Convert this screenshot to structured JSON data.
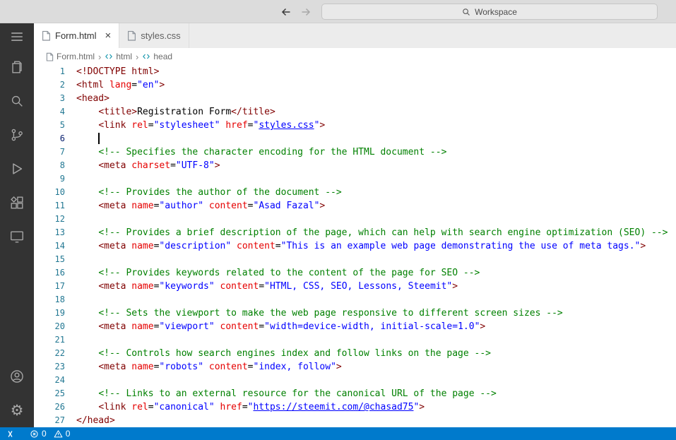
{
  "title_bar": {
    "search_label": "Workspace"
  },
  "activity_bar": {
    "icons": [
      "menu",
      "explorer",
      "search",
      "source-control",
      "run-and-debug",
      "extensions",
      "remote-explorer"
    ],
    "bottom_icons": [
      "account",
      "settings"
    ]
  },
  "tab_bar": {
    "tabs": [
      {
        "label": "Form.html",
        "active": true,
        "close_glyph": "×"
      },
      {
        "label": "styles.css",
        "active": false
      }
    ]
  },
  "breadcrumb": {
    "items": [
      "Form.html",
      "html",
      "head"
    ],
    "separator": "›"
  },
  "editor": {
    "cursor_line": 6,
    "lines": [
      [
        [
          "<!DOCTYPE html>",
          "t"
        ]
      ],
      [
        [
          "<html ",
          "t"
        ],
        [
          "lang",
          "a"
        ],
        [
          "=",
          "p"
        ],
        [
          "\"en\"",
          "s"
        ],
        [
          ">",
          "t"
        ]
      ],
      [
        [
          "<head>",
          "t"
        ]
      ],
      [
        [
          "    ",
          "p"
        ],
        [
          "<title>",
          "t"
        ],
        [
          "Registration Form",
          "p"
        ],
        [
          "</title>",
          "t"
        ]
      ],
      [
        [
          "    ",
          "p"
        ],
        [
          "<link ",
          "t"
        ],
        [
          "rel",
          "a"
        ],
        [
          "=",
          "p"
        ],
        [
          "\"stylesheet\"",
          "s"
        ],
        [
          " ",
          "p"
        ],
        [
          "href",
          "a"
        ],
        [
          "=",
          "p"
        ],
        [
          "\"",
          "s"
        ],
        [
          "styles.css",
          "l"
        ],
        [
          "\"",
          "s"
        ],
        [
          ">",
          "t"
        ]
      ],
      [
        [
          "    ",
          "p"
        ]
      ],
      [
        [
          "    ",
          "p"
        ],
        [
          "<!-- Specifies the character encoding for the HTML document -->",
          "c"
        ]
      ],
      [
        [
          "    ",
          "p"
        ],
        [
          "<meta ",
          "t"
        ],
        [
          "charset",
          "a"
        ],
        [
          "=",
          "p"
        ],
        [
          "\"UTF-8\"",
          "s"
        ],
        [
          ">",
          "t"
        ]
      ],
      [],
      [
        [
          "    ",
          "p"
        ],
        [
          "<!-- Provides the author of the document -->",
          "c"
        ]
      ],
      [
        [
          "    ",
          "p"
        ],
        [
          "<meta ",
          "t"
        ],
        [
          "name",
          "a"
        ],
        [
          "=",
          "p"
        ],
        [
          "\"author\"",
          "s"
        ],
        [
          " ",
          "p"
        ],
        [
          "content",
          "a"
        ],
        [
          "=",
          "p"
        ],
        [
          "\"Asad Fazal\"",
          "s"
        ],
        [
          ">",
          "t"
        ]
      ],
      [],
      [
        [
          "    ",
          "p"
        ],
        [
          "<!-- Provides a brief description of the page, which can help with search engine optimization (SEO) -->",
          "c"
        ]
      ],
      [
        [
          "    ",
          "p"
        ],
        [
          "<meta ",
          "t"
        ],
        [
          "name",
          "a"
        ],
        [
          "=",
          "p"
        ],
        [
          "\"description\"",
          "s"
        ],
        [
          " ",
          "p"
        ],
        [
          "content",
          "a"
        ],
        [
          "=",
          "p"
        ],
        [
          "\"This is an example web page demonstrating the use of meta tags.\"",
          "s"
        ],
        [
          ">",
          "t"
        ]
      ],
      [],
      [
        [
          "    ",
          "p"
        ],
        [
          "<!-- Provides keywords related to the content of the page for SEO -->",
          "c"
        ]
      ],
      [
        [
          "    ",
          "p"
        ],
        [
          "<meta ",
          "t"
        ],
        [
          "name",
          "a"
        ],
        [
          "=",
          "p"
        ],
        [
          "\"keywords\"",
          "s"
        ],
        [
          " ",
          "p"
        ],
        [
          "content",
          "a"
        ],
        [
          "=",
          "p"
        ],
        [
          "\"HTML, CSS, SEO, Lessons, Steemit\"",
          "s"
        ],
        [
          ">",
          "t"
        ]
      ],
      [],
      [
        [
          "    ",
          "p"
        ],
        [
          "<!-- Sets the viewport to make the web page responsive to different screen sizes -->",
          "c"
        ]
      ],
      [
        [
          "    ",
          "p"
        ],
        [
          "<meta ",
          "t"
        ],
        [
          "name",
          "a"
        ],
        [
          "=",
          "p"
        ],
        [
          "\"viewport\"",
          "s"
        ],
        [
          " ",
          "p"
        ],
        [
          "content",
          "a"
        ],
        [
          "=",
          "p"
        ],
        [
          "\"width=device-width, initial-scale=1.0\"",
          "s"
        ],
        [
          ">",
          "t"
        ]
      ],
      [],
      [
        [
          "    ",
          "p"
        ],
        [
          "<!-- Controls how search engines index and follow links on the page -->",
          "c"
        ]
      ],
      [
        [
          "    ",
          "p"
        ],
        [
          "<meta ",
          "t"
        ],
        [
          "name",
          "a"
        ],
        [
          "=",
          "p"
        ],
        [
          "\"robots\"",
          "s"
        ],
        [
          " ",
          "p"
        ],
        [
          "content",
          "a"
        ],
        [
          "=",
          "p"
        ],
        [
          "\"index, follow\"",
          "s"
        ],
        [
          ">",
          "t"
        ]
      ],
      [],
      [
        [
          "    ",
          "p"
        ],
        [
          "<!-- Links to an external resource for the canonical URL of the page -->",
          "c"
        ]
      ],
      [
        [
          "    ",
          "p"
        ],
        [
          "<link ",
          "t"
        ],
        [
          "rel",
          "a"
        ],
        [
          "=",
          "p"
        ],
        [
          "\"canonical\"",
          "s"
        ],
        [
          " ",
          "p"
        ],
        [
          "href",
          "a"
        ],
        [
          "=",
          "p"
        ],
        [
          "\"",
          "s"
        ],
        [
          "https://steemit.com/@chasad75",
          "l"
        ],
        [
          "\"",
          "s"
        ],
        [
          ">",
          "t"
        ]
      ],
      [
        [
          "</head>",
          "t"
        ]
      ]
    ]
  },
  "status_bar": {
    "error_count": "0",
    "warning_count": "0"
  },
  "colors": {
    "status_bar": "#007acc",
    "activity_bar": "#333333",
    "tag": "#800000",
    "attribute": "#e50000",
    "string": "#0000ff",
    "comment": "#008000"
  }
}
